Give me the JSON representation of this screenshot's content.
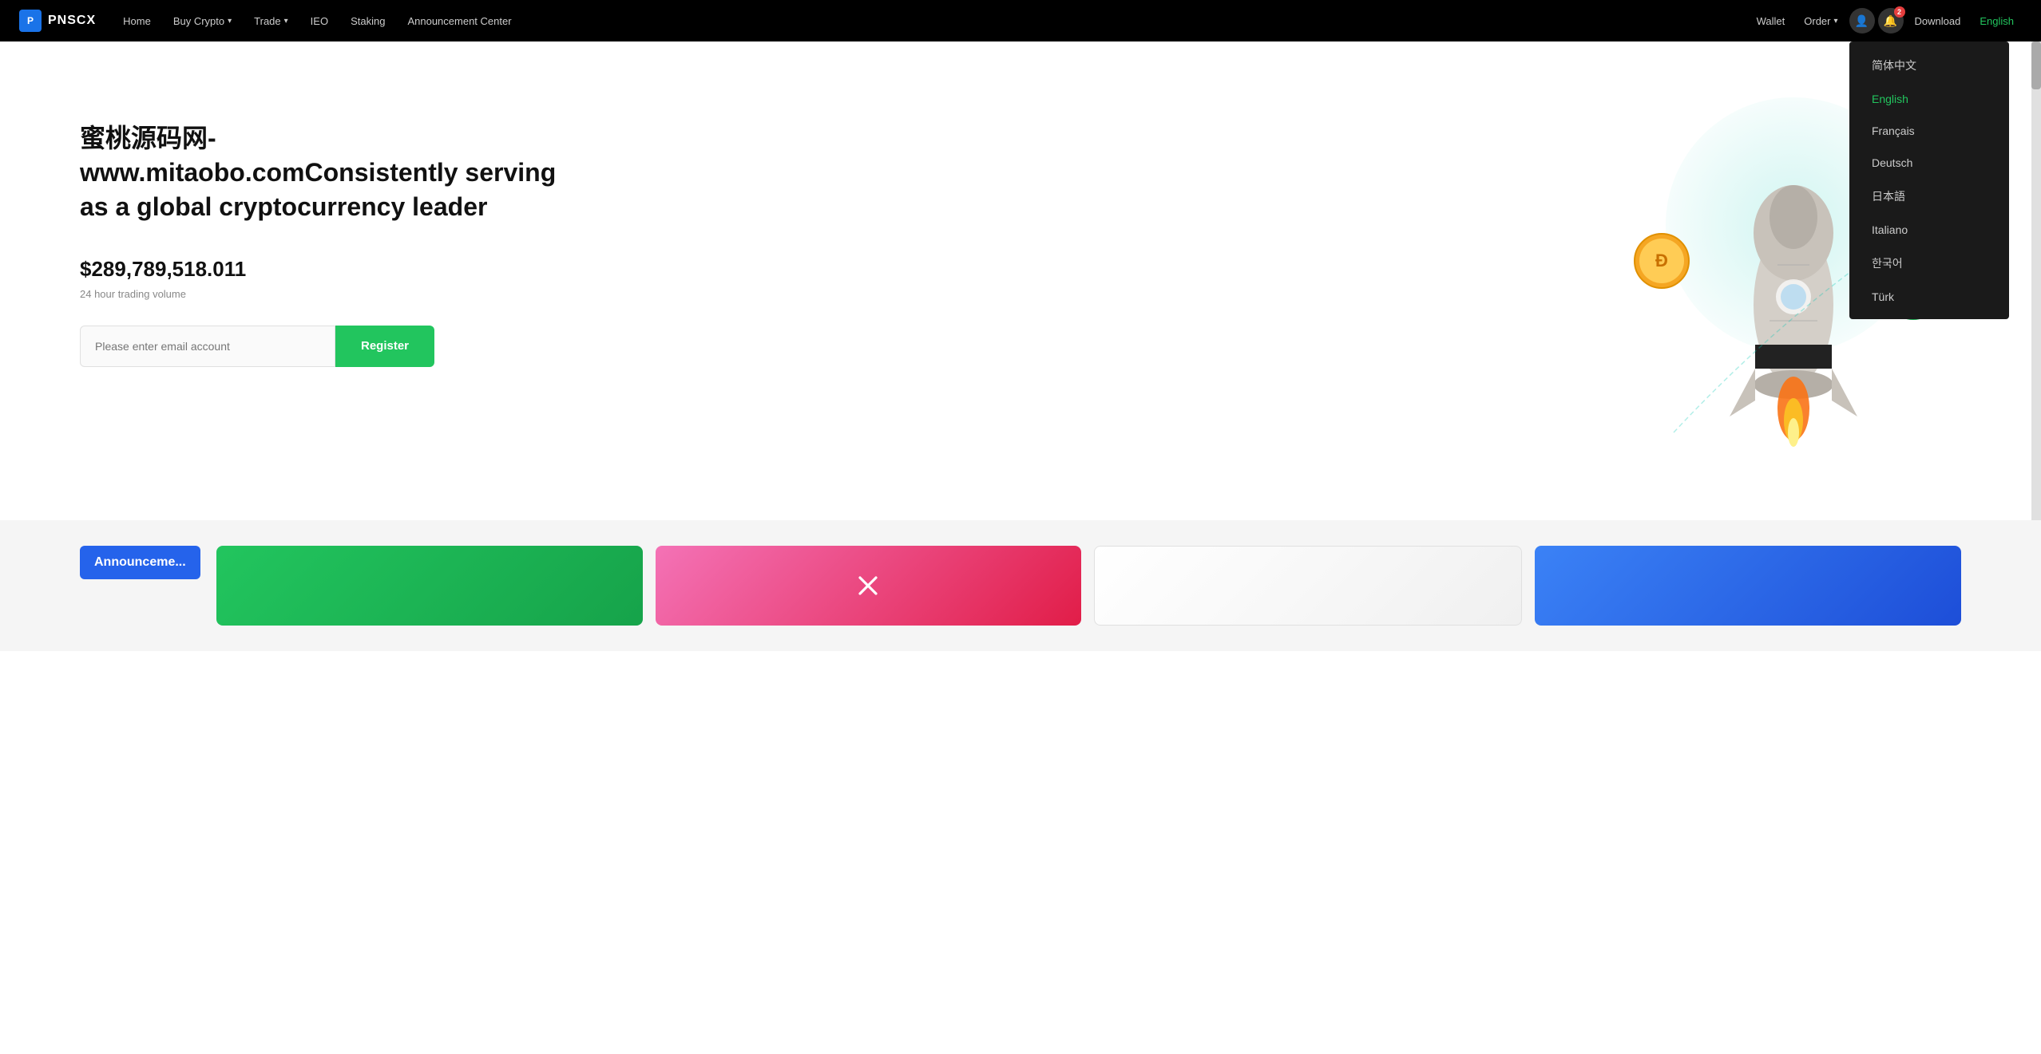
{
  "navbar": {
    "logo_icon": "🔷",
    "logo_text": "PNSCX",
    "home_label": "Home",
    "buy_crypto_label": "Buy Crypto",
    "trade_label": "Trade",
    "ieo_label": "IEO",
    "staking_label": "Staking",
    "announcement_label": "Announcement Center",
    "wallet_label": "Wallet",
    "order_label": "Order",
    "download_label": "Download",
    "english_label": "English",
    "notification_badge": "2"
  },
  "hero": {
    "title": "蜜桃源码网-www.mitaobo.comConsistently serving as a global cryptocurrency leader",
    "volume_amount": "$289,789,518.011",
    "volume_label": "24 hour trading volume",
    "email_placeholder": "Please enter email account",
    "register_label": "Register"
  },
  "language_dropdown": {
    "items": [
      {
        "label": "简体中文",
        "active": false
      },
      {
        "label": "English",
        "active": true
      },
      {
        "label": "Français",
        "active": false
      },
      {
        "label": "Deutsch",
        "active": false
      },
      {
        "label": "日本語",
        "active": false
      },
      {
        "label": "Italiano",
        "active": false
      },
      {
        "label": "한국어",
        "active": false
      },
      {
        "label": "Türk",
        "active": false
      }
    ]
  },
  "bottom": {
    "announcement_label": "Announceme..."
  },
  "icons": {
    "user_icon": "👤",
    "bell_icon": "🔔",
    "chevron_down": "▾"
  }
}
